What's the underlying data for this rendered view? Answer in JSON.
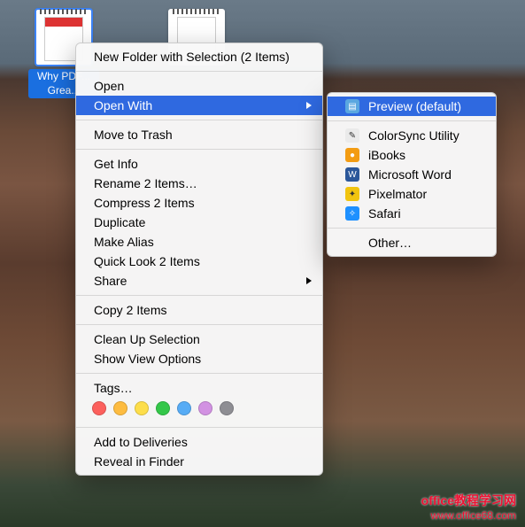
{
  "desktop": {
    "files": [
      {
        "label": "Why PDF...\nGrea..."
      },
      {
        "label": ""
      }
    ]
  },
  "context_menu": {
    "new_folder": "New Folder with Selection (2 Items)",
    "open": "Open",
    "open_with": "Open With",
    "move_to_trash": "Move to Trash",
    "get_info": "Get Info",
    "rename": "Rename 2 Items…",
    "compress": "Compress 2 Items",
    "duplicate": "Duplicate",
    "make_alias": "Make Alias",
    "quick_look": "Quick Look 2 Items",
    "share": "Share",
    "copy": "Copy 2 Items",
    "clean_up": "Clean Up Selection",
    "show_view": "Show View Options",
    "tags": "Tags…",
    "add_deliveries": "Add to Deliveries",
    "reveal": "Reveal in Finder"
  },
  "tag_colors": [
    "#fc605c",
    "#fdbc40",
    "#fdde4a",
    "#34c749",
    "#57acf5",
    "#d292e2",
    "#8e8e93"
  ],
  "submenu": {
    "preview": "Preview (default)",
    "colorsync": "ColorSync Utility",
    "ibooks": "iBooks",
    "word": "Microsoft Word",
    "pixelmator": "Pixelmator",
    "safari": "Safari",
    "other": "Other…"
  },
  "app_icon_styles": {
    "preview": {
      "bg": "#5aa7e0",
      "txt": "▤"
    },
    "colorsync": {
      "bg": "#eaeaea",
      "txt": "✎",
      "fg": "#333"
    },
    "ibooks": {
      "bg": "#f39c12",
      "txt": "●"
    },
    "word": {
      "bg": "#2b579a",
      "txt": "W"
    },
    "pixelmator": {
      "bg": "#f1c40f",
      "txt": "✦",
      "fg": "#333"
    },
    "safari": {
      "bg": "#1e90ff",
      "txt": "✧"
    }
  },
  "watermark": {
    "line1": "office教程学习网",
    "line2": "www.office68.com"
  }
}
